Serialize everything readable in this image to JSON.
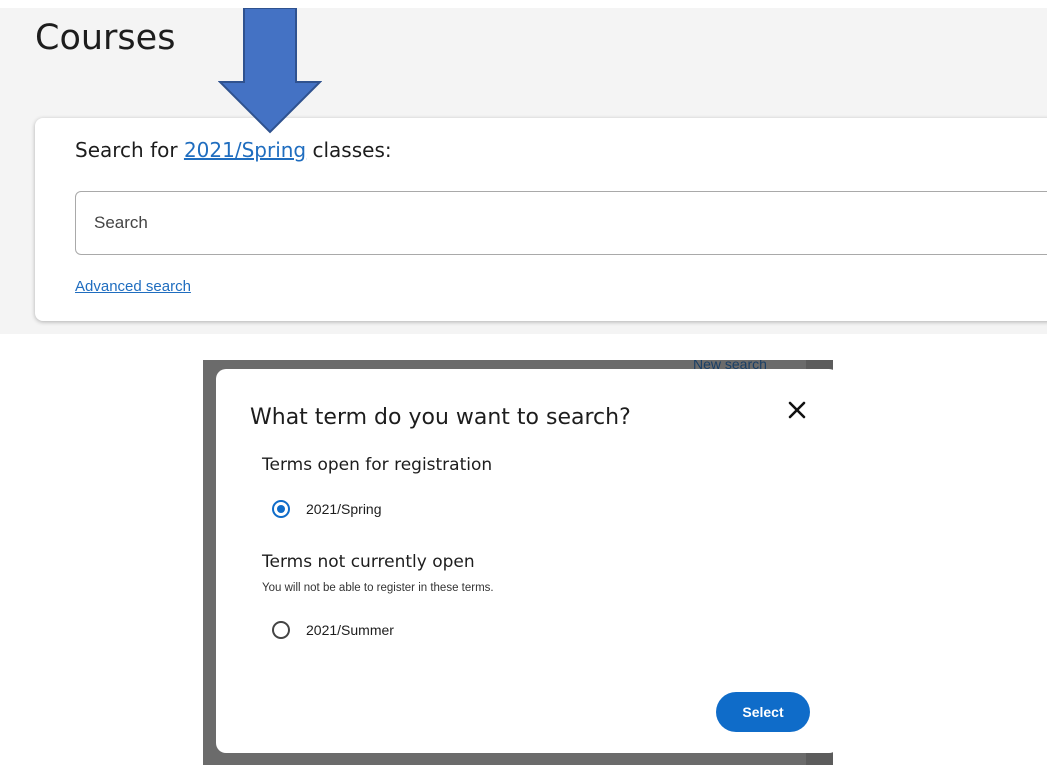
{
  "page": {
    "title": "Courses"
  },
  "search": {
    "heading_prefix": "Search for",
    "term": "2021/Spring",
    "heading_suffix": "classes:",
    "placeholder": "Search",
    "advanced_link": "Advanced search"
  },
  "annotation": {
    "arrow_color": "#4472c4",
    "arrow_icon": "down-arrow"
  },
  "background": {
    "new_search": "New search"
  },
  "dialog": {
    "title": "What term do you want to search?",
    "close_icon": "close-icon",
    "open_group": {
      "label": "Terms open for registration",
      "options": [
        {
          "label": "2021/Spring",
          "checked": true
        }
      ]
    },
    "closed_group": {
      "label": "Terms not currently open",
      "note": "You will not be able to register in these terms.",
      "options": [
        {
          "label": "2021/Summer",
          "checked": false
        }
      ]
    },
    "select_label": "Select",
    "accent_color": "#0f6cc9"
  }
}
